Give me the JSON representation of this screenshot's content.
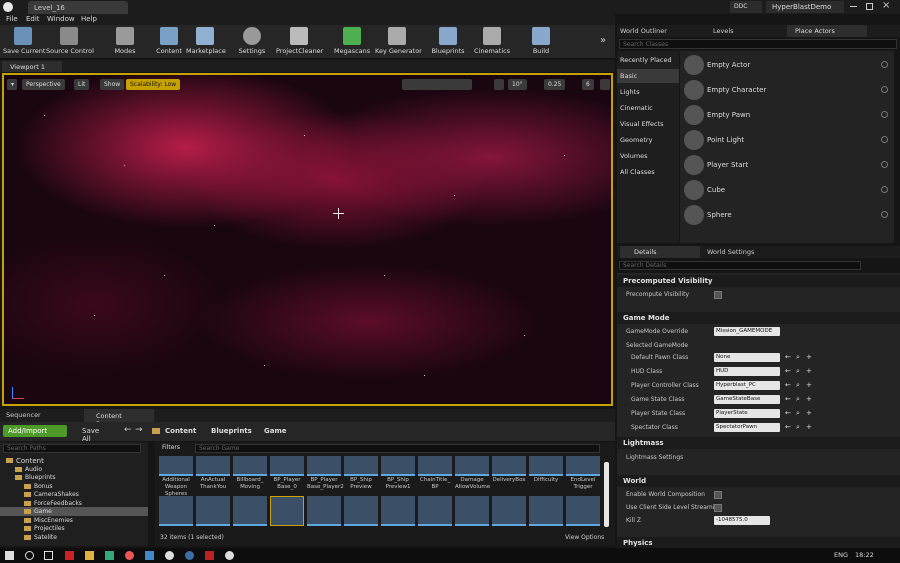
{
  "titlebar": {
    "tab_label": "Level_16",
    "ddc_label": "DDC",
    "project_name": "HyperBlastDemo"
  },
  "menu": {
    "items": [
      "File",
      "Edit",
      "Window",
      "Help"
    ]
  },
  "toolbar": {
    "items": [
      "Save Current",
      "Source Control",
      "Modes",
      "Content",
      "Marketplace",
      "Settings",
      "ProjectCleaner",
      "Megascans",
      "Key Generator",
      "Blueprints",
      "Cinematics",
      "Build"
    ],
    "more": "»"
  },
  "viewport": {
    "tab": "Viewport 1",
    "perspective": "Perspective",
    "lit": "Lit",
    "show": "Show",
    "scalability": "Scalability: Low",
    "angle": "10°",
    "scale": "0.25",
    "camera_speed": "6"
  },
  "bottom_tabs": [
    "Sequencer",
    "Content Browser"
  ],
  "content_browser": {
    "add_import": "Add/Import",
    "save_all": "Save All",
    "path": [
      "Content",
      "Blueprints",
      "Game"
    ],
    "search_paths_placeholder": "Search Paths",
    "filters": "Filters",
    "search_game_placeholder": "Search Game",
    "tree": [
      {
        "label": "Content",
        "indent": 0
      },
      {
        "label": "Audio",
        "indent": 1
      },
      {
        "label": "Blueprints",
        "indent": 1
      },
      {
        "label": "Bonus",
        "indent": 2
      },
      {
        "label": "CameraShakes",
        "indent": 2
      },
      {
        "label": "ForceFeedbacks",
        "indent": 2
      },
      {
        "label": "Game",
        "indent": 2
      },
      {
        "label": "MiscEnemies",
        "indent": 2
      },
      {
        "label": "Projectiles",
        "indent": 2
      },
      {
        "label": "Satelite",
        "indent": 2
      }
    ],
    "assets_row1": [
      "Additional Weapon Spheres",
      "AnActual ThankYou",
      "Billboard_ Moving",
      "BP_Player Base_0",
      "BP_Player Base_Player2",
      "BP_Ship Preview",
      "BP_Ship Preview1",
      "ChainTitle_ BP",
      "Damage AllowVolume",
      "DeliveryBox",
      "Difficulty",
      "EndLevel Trigger"
    ],
    "item_count": "32 items (1 selected)",
    "view_options": "View Options"
  },
  "place_actors": {
    "tabs": [
      "World Outliner",
      "Levels",
      "Place Actors"
    ],
    "search_placeholder": "Search Classes",
    "categories": [
      "Recently Placed",
      "Basic",
      "Lights",
      "Cinematic",
      "Visual Effects",
      "Geometry",
      "Volumes",
      "All Classes"
    ],
    "items": [
      "Empty Actor",
      "Empty Character",
      "Empty Pawn",
      "Point Light",
      "Player Start",
      "Cube",
      "Sphere"
    ]
  },
  "details": {
    "tabs": [
      "Details",
      "World Settings"
    ],
    "search_placeholder": "Search Details",
    "sections": {
      "precomputed_visibility": "Precomputed Visibility",
      "precompute_visibility_label": "Precompute Visibility",
      "game_mode": "Game Mode",
      "gamemode_override_label": "GameMode Override",
      "gamemode_override_value": "Mission_GAMEMODE",
      "selected_gamemode": "Selected GameMode",
      "lightmass": "Lightmass",
      "lightmass_settings": "Lightmass Settings",
      "world": "World",
      "physics": "Physics"
    },
    "gamemode_rows": [
      {
        "label": "Default Pawn Class",
        "value": "None"
      },
      {
        "label": "HUD Class",
        "value": "HUD"
      },
      {
        "label": "Player Controller Class",
        "value": "Hyperblast_PC"
      },
      {
        "label": "Game State Class",
        "value": "GameStateBase"
      },
      {
        "label": "Player State Class",
        "value": "PlayerState"
      },
      {
        "label": "Spectator Class",
        "value": "SpectatorPawn"
      }
    ],
    "world_rows": [
      {
        "label": "Enable World Composition"
      },
      {
        "label": "Use Client Side Level Streaming"
      }
    ],
    "kill_z_label": "Kill Z",
    "kill_z_value": "-1048575.0"
  },
  "taskbar": {
    "lang": "ENG",
    "time": "18:22"
  }
}
